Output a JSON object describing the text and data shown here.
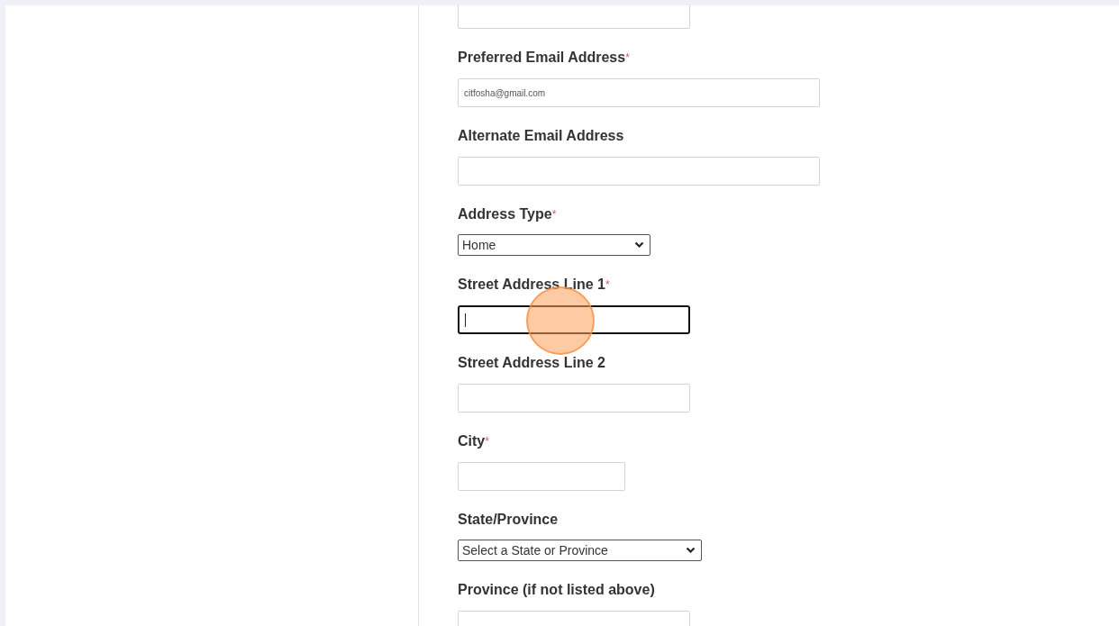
{
  "fields": [
    {
      "kind": "input",
      "focused": false
    },
    {
      "kind": "input",
      "label": "Preferred Email Address",
      "required_mark": "*",
      "value": "citfosha@gmail.com",
      "focused": false
    },
    {
      "kind": "input",
      "label": "Alternate Email Address",
      "focused": false
    },
    {
      "kind": "select",
      "label": "Address Type",
      "required_mark": "*",
      "value": "Home"
    },
    {
      "kind": "input",
      "label": "Street Address Line 1",
      "required_mark": "*",
      "focused": true
    },
    {
      "kind": "input",
      "label": "Street Address Line 2",
      "focused": false
    },
    {
      "kind": "input",
      "label": "City",
      "required_mark": "*",
      "focused": false
    },
    {
      "kind": "select",
      "label": "State/Province",
      "value": "Select a State or Province"
    },
    {
      "kind": "input",
      "label": "Province (if not listed above)",
      "focused": false
    }
  ]
}
